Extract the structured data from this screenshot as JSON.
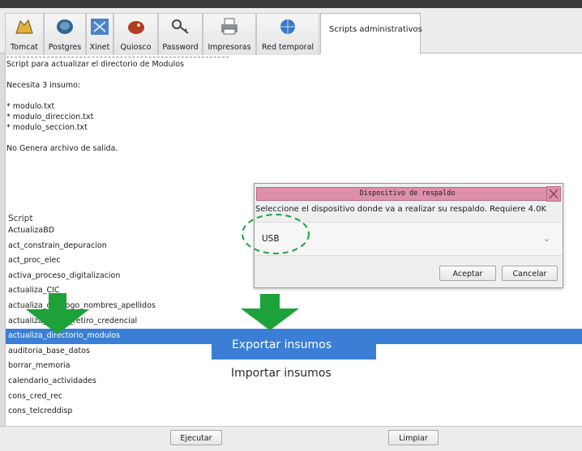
{
  "toolbar": {
    "tabs": [
      {
        "label": "Tomcat",
        "icon": "tomcat-icon"
      },
      {
        "label": "Postgres",
        "icon": "postgres-elephant-icon"
      },
      {
        "label": "Xinet",
        "icon": "xinet-icon"
      },
      {
        "label": "Quiosco",
        "icon": "kiosk-icon"
      },
      {
        "label": "Password",
        "icon": "key-icon"
      },
      {
        "label": "Impresoras",
        "icon": "printer-icon"
      },
      {
        "label": "Red temporal",
        "icon": "globe-network-icon"
      }
    ],
    "active_tab": "Scripts administrativos"
  },
  "description": {
    "lines": [
      "Script para actualizar el directorio de Modulos",
      "",
      "Necesita 3 insumo:",
      "",
      "* modulo.txt",
      "* modulo_direccion.txt",
      "* modulo_seccion.txt",
      "",
      "No Genera archivo de salida."
    ]
  },
  "scripts": {
    "header": "Script",
    "items": [
      "ActualizaBD",
      "act_constrain_depuracion",
      "act_proc_elec",
      "activa_proceso_digitalizacion",
      "actualiza_CIC",
      "actualiza_catalogo_nombres_apellidos",
      "actualiza_causa_retiro_credencial",
      "actualiza_directorio_modulos",
      "auditoria_base_datos",
      "borrar_memoria",
      "calendario_actividades",
      "cons_cred_rec",
      "cons_telcreddisp"
    ],
    "selected_index": 7
  },
  "context_menu": {
    "export_label": "Exportar insumos",
    "import_label": "Importar insumos"
  },
  "buttons": {
    "run_label": "Ejecutar",
    "clear_label": "Limpiar"
  },
  "dialog": {
    "title": "Dispositivo de respaldo",
    "message": "Seleccione el dispositivo donde va a realizar su respaldo. Requiere 4.0K",
    "selected_device": "USB",
    "ok_label": "Aceptar",
    "cancel_label": "Cancelar"
  },
  "colors": {
    "selection": "#3a7fd5",
    "dialog_title": "#dd8fac",
    "annotation_arrow": "#1da23a"
  }
}
